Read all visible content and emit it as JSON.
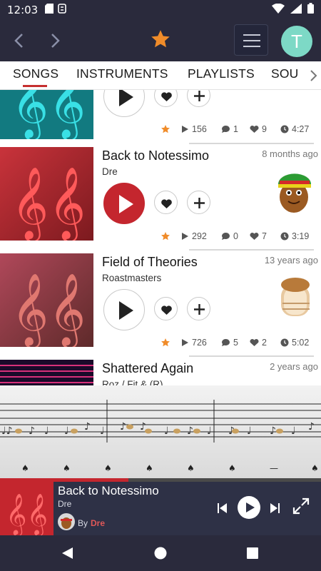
{
  "status": {
    "time": "12:03"
  },
  "header": {
    "avatar_letter": "T"
  },
  "tabs": [
    {
      "label": "SONGS"
    },
    {
      "label": "INSTRUMENTS"
    },
    {
      "label": "PLAYLISTS"
    },
    {
      "label": "SOU"
    }
  ],
  "songs": [
    {
      "title": "",
      "artist": "",
      "ago": "",
      "plays": "156",
      "comments": "1",
      "likes": "9",
      "duration": "4:27"
    },
    {
      "title": "Back to Notessimo",
      "artist": "Dre",
      "ago": "8 months ago",
      "plays": "292",
      "comments": "0",
      "likes": "7",
      "duration": "3:19"
    },
    {
      "title": "Field of Theories",
      "artist": "Roastmasters",
      "ago": "13 years ago",
      "plays": "726",
      "comments": "5",
      "likes": "2",
      "duration": "5:02"
    },
    {
      "title": "Shattered Again",
      "artist": "Roz / Fit & (R)",
      "ago": "2 years ago"
    }
  ],
  "player": {
    "title": "Back to Notessimo",
    "artist": "Dre",
    "by_label": "By",
    "by_name": "Dre",
    "progress": 0.4
  },
  "colors": {
    "accent": "#c4262e",
    "star": "#f08c2a",
    "bar": "#2a2a3c"
  }
}
